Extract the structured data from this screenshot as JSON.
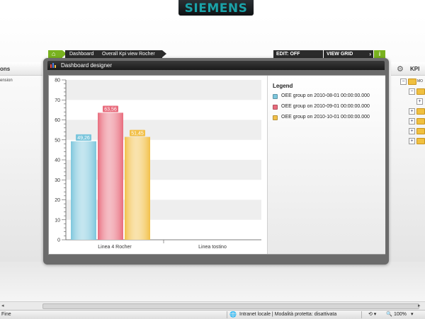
{
  "header": {
    "logo": "SIEMENS"
  },
  "left_panel": {
    "title": "ons",
    "subtitle": "ension"
  },
  "right_panel": {
    "title": "KPI",
    "tree_first_label": "MO"
  },
  "breadcrumb": {
    "items": [
      "Dashboard",
      "Overall Kpi view Rocher"
    ]
  },
  "toolbar": {
    "edit_label": "EDIT: OFF",
    "view_grid_label": "VIEW GRID",
    "info_label": "i"
  },
  "dialog": {
    "title": "Dashboard designer"
  },
  "legend": {
    "title": "Legend"
  },
  "chart_data": {
    "type": "bar",
    "categories": [
      "Linea 4 Rocher",
      "Linea tostino"
    ],
    "series": [
      {
        "name": "OEE group on 2010-08-01 00:00:00.000",
        "values": [
          49.26,
          null
        ],
        "labels": [
          "49,26",
          ""
        ],
        "color": "#7cc6dc"
      },
      {
        "name": "OEE group on 2010-09-01 00:00:00.000",
        "values": [
          63.56,
          null
        ],
        "labels": [
          "63,56",
          ""
        ],
        "color": "#e86b7c"
      },
      {
        "name": "OEE group on 2010-10-01 00:00:00.000",
        "values": [
          51.45,
          null
        ],
        "labels": [
          "51,45",
          ""
        ],
        "color": "#f2c048"
      }
    ],
    "ylim": [
      0,
      80
    ],
    "yticks": [
      "0",
      "10",
      "20",
      "30",
      "40",
      "50",
      "60",
      "70",
      "80"
    ],
    "grid": true,
    "legend_position": "right"
  },
  "status": {
    "left": "Fine",
    "zone": "Intranet locale | Modalità protetta: disattivata",
    "zoom": "100%"
  }
}
